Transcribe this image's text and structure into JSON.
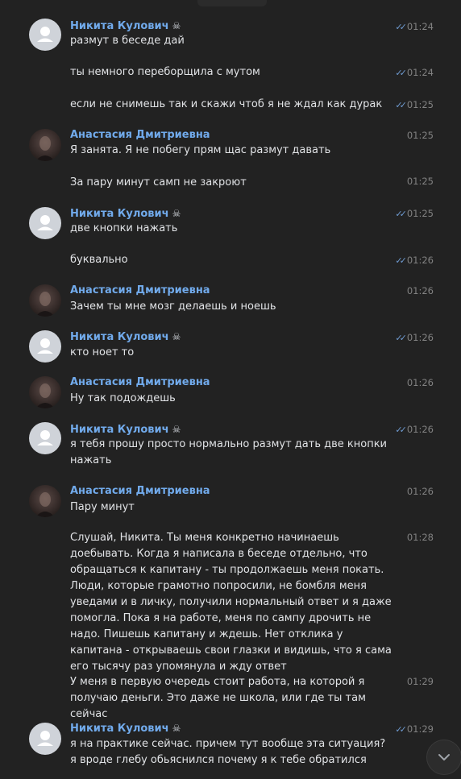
{
  "senders": {
    "nikita": "Никита Кулович",
    "anastasia": "Анастасия Дмитриевна"
  },
  "messages": [
    {
      "sender": "nikita",
      "text": "размут в беседе дай",
      "time": "01:24",
      "read": true
    },
    {
      "text": "ты немного переборщила с мутом",
      "time": "01:24",
      "read": true
    },
    {
      "text": "если не снимешь так и скажи чтоб я не ждал как дурак",
      "time": "01:25",
      "read": true
    },
    {
      "sender": "anastasia",
      "text": "Я занята. Я не побегу прям щас размут давать",
      "time": "01:25",
      "read": false
    },
    {
      "text": "За пару минут самп не закроют",
      "time": "01:25",
      "read": false
    },
    {
      "sender": "nikita",
      "text": "две кнопки нажать",
      "time": "01:25",
      "read": true
    },
    {
      "text": "буквально",
      "time": "01:26",
      "read": true
    },
    {
      "sender": "anastasia",
      "text": "Зачем ты мне мозг делаешь и ноешь",
      "time": "01:26",
      "read": false
    },
    {
      "sender": "nikita",
      "text": "кто ноет то",
      "time": "01:26",
      "read": true
    },
    {
      "sender": "anastasia",
      "text": "Ну так подождешь",
      "time": "01:26",
      "read": false
    },
    {
      "sender": "nikita",
      "text": "я тебя прошу просто нормально размут дать две кнопки нажать",
      "time": "01:26",
      "read": true
    },
    {
      "sender": "anastasia",
      "text": "Пару минут",
      "time": "01:26",
      "read": false
    },
    {
      "text": "Слушай, Никита. Ты меня конкретно начинаешь доебывать. Когда я написала в беседе отдельно, что обращаться к капитану - ты продолжаешь меня покать. Люди, которые грамотно попросили, не бомбля меня уведами и в личку, получили нормальный ответ и я даже помогла. Пока я на работе, меня по сампу дрочить не надо. Пишешь капитану и ждешь. Нет отклика у капитана - открываешь свои глазки и видишь, что я сама его тысячу раз упомянула и жду ответ",
      "time": "01:28",
      "read": false
    },
    {
      "text": "У меня в первую очередь стоит работа, на которой я получаю деньги. Это даже не школа, или где ты там сейчас",
      "time": "01:29",
      "read": false
    },
    {
      "sender": "nikita",
      "text": "я на практике сейчас. причем тут вообще эта ситуация? я вроде глебу обьяснился почему я к тебе обратился",
      "time": "01:29",
      "read": true
    }
  ]
}
